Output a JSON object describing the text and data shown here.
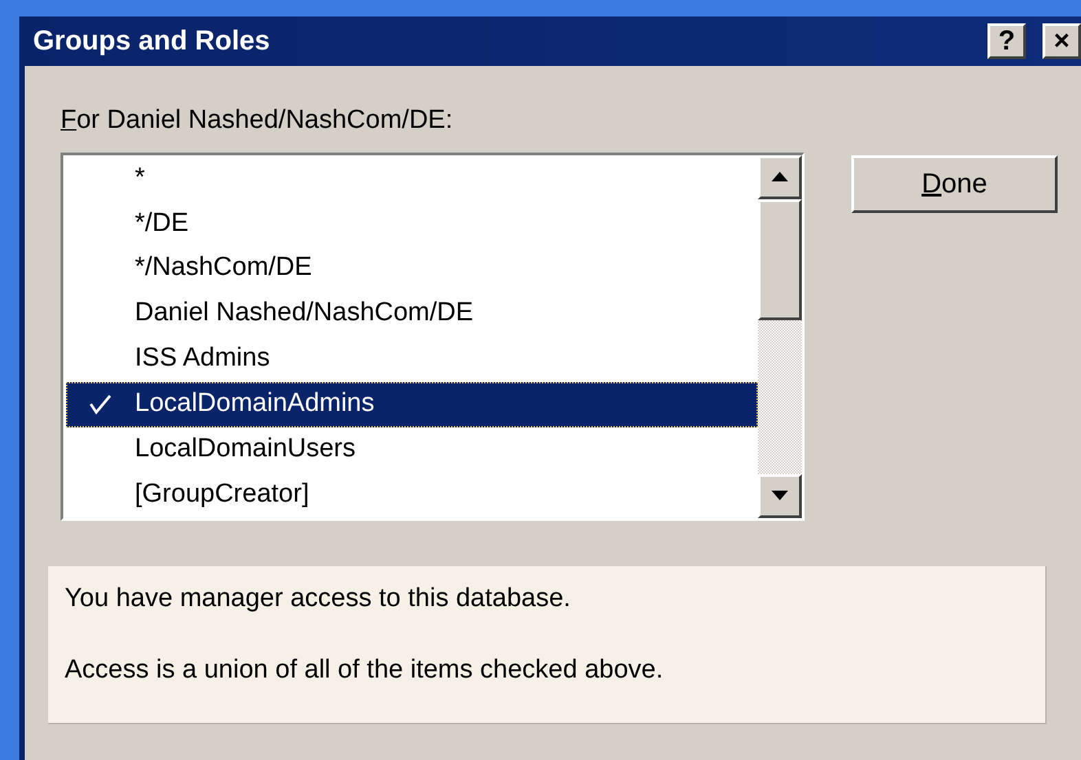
{
  "window": {
    "title": "Groups and Roles",
    "title_buttons": [
      "?",
      "×"
    ]
  },
  "list_label": {
    "text": "For Daniel Nashed/NashCom/DE:",
    "access_key_underlined": true
  },
  "entries": [
    {
      "label": "*",
      "checked": false,
      "selected": false
    },
    {
      "label": "*/DE",
      "checked": false,
      "selected": false
    },
    {
      "label": "*/NashCom/DE",
      "checked": false,
      "selected": false
    },
    {
      "label": "Daniel Nashed/NashCom/DE",
      "checked": false,
      "selected": false
    },
    {
      "label": "ISS Admins",
      "checked": false,
      "selected": false
    },
    {
      "label": "LocalDomainAdmins",
      "checked": true,
      "selected": true
    },
    {
      "label": "LocalDomainUsers",
      "checked": false,
      "selected": false
    },
    {
      "label": "[GroupCreator]",
      "checked": false,
      "selected": false
    }
  ],
  "done_button": {
    "label": "Done",
    "access_key_underlined": true
  },
  "info": [
    "You have manager access to this database.",
    "Access is a union of all of the items checked above."
  ]
}
